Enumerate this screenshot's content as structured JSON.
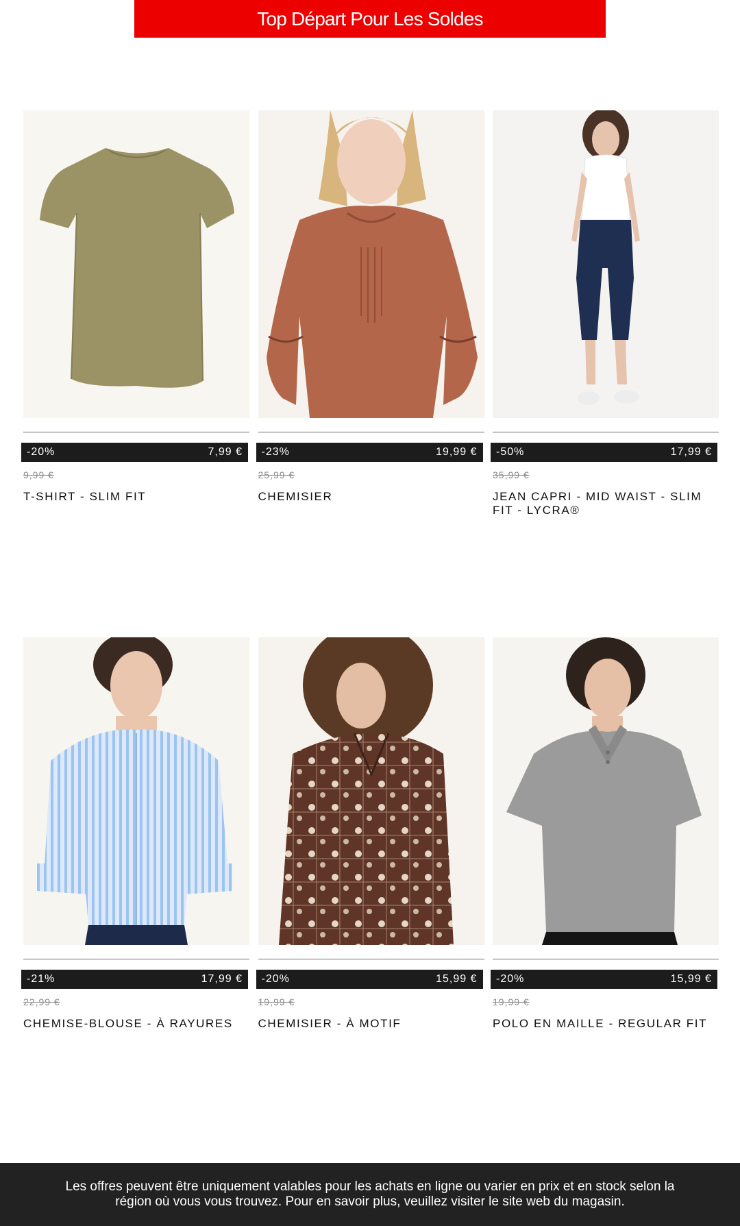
{
  "banner": {
    "title": "Top Départ Pour Les Soldes"
  },
  "colors": {
    "banner": "#ec0000",
    "price_bar": "#1c1c1c",
    "footer": "#222222"
  },
  "products": [
    {
      "discount": "-20%",
      "price": "7,99 €",
      "old_price": "9,99 €",
      "name": "T-SHIRT - SLIM FIT",
      "image": "olive-tshirt"
    },
    {
      "discount": "-23%",
      "price": "19,99 €",
      "old_price": "25,99 €",
      "name": "CHEMISIER",
      "image": "rust-blouse-model"
    },
    {
      "discount": "-50%",
      "price": "17,99 €",
      "old_price": "35,99 €",
      "name": "JEAN CAPRI - MID WAIST - SLIM FIT - LYCRA®",
      "image": "capri-jeans-model"
    },
    {
      "discount": "-21%",
      "price": "17,99 €",
      "old_price": "22,99 €",
      "name": "CHEMISE-BLOUSE - À RAYURES",
      "image": "striped-blouse-model"
    },
    {
      "discount": "-20%",
      "price": "15,99 €",
      "old_price": "19,99 €",
      "name": "CHEMISIER - À MOTIF",
      "image": "paisley-blouse-model"
    },
    {
      "discount": "-20%",
      "price": "15,99 €",
      "old_price": "19,99 €",
      "name": "POLO EN MAILLE - REGULAR FIT",
      "image": "grey-knit-polo-model"
    }
  ],
  "footer": {
    "text": "Les offres peuvent être uniquement valables pour les achats en ligne ou varier en prix et en stock selon la région où vous vous trouvez. Pour en savoir plus, veuillez visiter le site web du magasin."
  }
}
